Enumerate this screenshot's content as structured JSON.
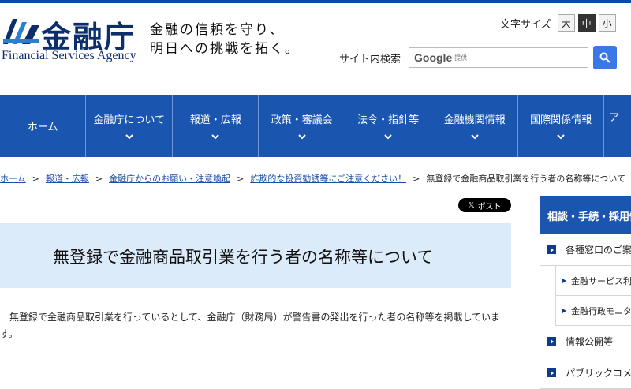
{
  "header": {
    "logo_kanji": "金融庁",
    "logo_english": "Financial Services Agency",
    "tagline_line1": "金融の信頼を守り、",
    "tagline_line2": "明日への挑戦を拓く。",
    "font_size_label": "文字サイズ",
    "font_sizes": [
      "大",
      "中",
      "小"
    ],
    "font_size_active": "中",
    "search_label": "サイト内検索",
    "search_logo": "Google",
    "search_sub": "提供"
  },
  "nav": {
    "items": [
      "ホーム",
      "金融庁について",
      "報道・広報",
      "政策・審議会",
      "法令・指針等",
      "金融機関情報",
      "国際関係情報",
      "ア"
    ]
  },
  "breadcrumb": {
    "items": [
      "ホーム",
      "報道・広報",
      "金融庁からのお願い・注意喚起",
      "詐欺的な投資勧誘等にご注意ください！"
    ],
    "current": "無登録で金融商品取引業を行う者の名称等について",
    "separator": ">"
  },
  "share": {
    "x_post_label": "ポスト",
    "x_glyph": "𝕏"
  },
  "main": {
    "title": "無登録で金融商品取引業を行う者の名称等について",
    "body": "無登録で金融商品取引業を行っているとして、金融庁（財務局）が警告書の発出を行った者の名称等を掲載しています。"
  },
  "sidebar": {
    "heading": "相談・手続・採用情",
    "items": [
      {
        "label": "各種窓口のご案"
      },
      {
        "label": "金融サービス利",
        "sub": true
      },
      {
        "label": "金融行政モニタ",
        "sub": true
      },
      {
        "label": "情報公開等"
      },
      {
        "label": "パブリックコメ"
      }
    ]
  },
  "colors": {
    "brand_blue": "#1a56b0",
    "title_band": "#dcebfa",
    "link": "#1a4fa6"
  }
}
